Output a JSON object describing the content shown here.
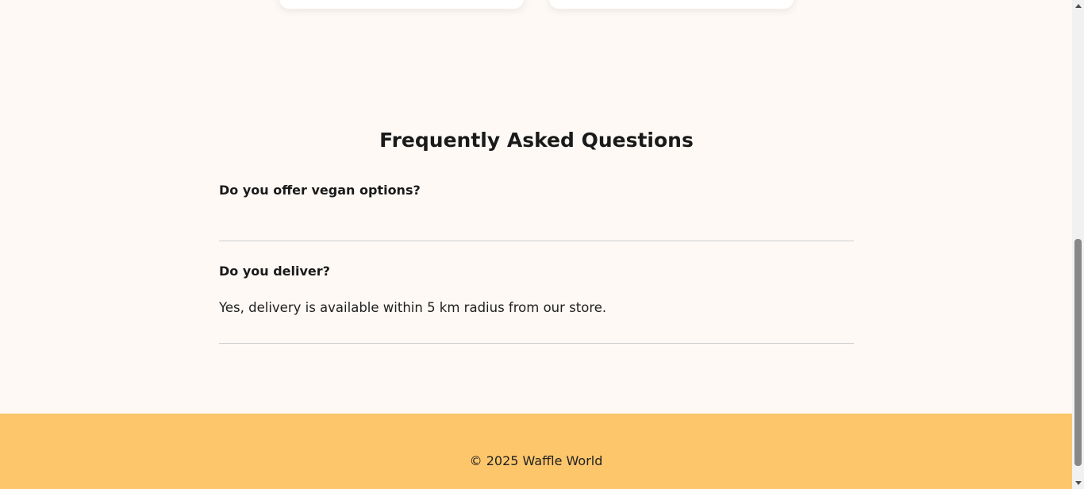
{
  "faq": {
    "title": "Frequently Asked Questions",
    "items": [
      {
        "question": "Do you offer vegan options?",
        "answer": ""
      },
      {
        "question": "Do you deliver?",
        "answer": "Yes, delivery is available within 5 km radius from our store."
      }
    ]
  },
  "footer": {
    "copyright": "© 2025 Waffle World"
  },
  "colors": {
    "page_background": "#fef9f5",
    "footer_background": "#fdc66b",
    "divider": "#cfcfcf"
  },
  "icons": {
    "scroll_up": "triangle-up-icon",
    "scroll_down": "triangle-down-icon"
  }
}
